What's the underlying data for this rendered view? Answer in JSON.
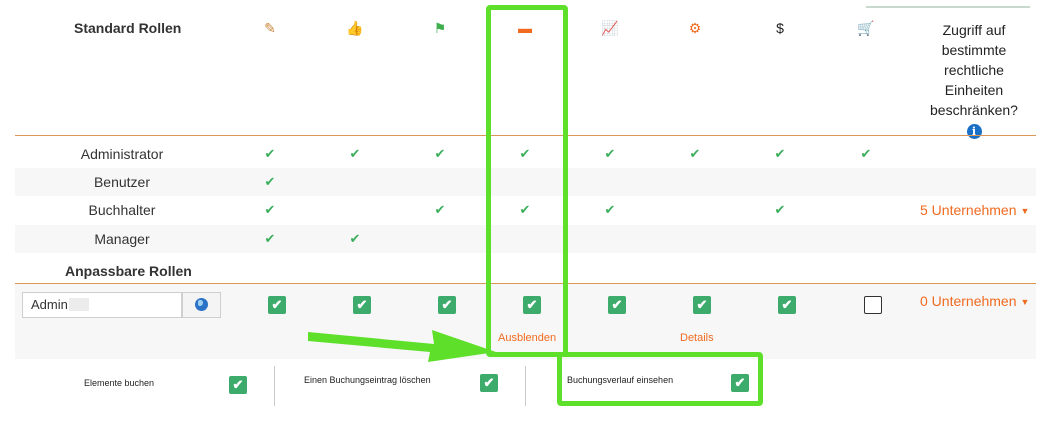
{
  "header": {
    "title": "Standard Rollen",
    "access_label": "Zugriff auf bestimmte rechtliche Einheiten beschränken?",
    "info_symbol": "i",
    "columns": [
      {
        "icon": "edit-icon",
        "glyph": "✎",
        "color": "#c8863a"
      },
      {
        "icon": "thumbs-up-icon",
        "glyph": "👍",
        "color": "#1f7ad6"
      },
      {
        "icon": "flag-icon",
        "glyph": "⚑",
        "color": "#3fae4e"
      },
      {
        "icon": "archive-icon",
        "glyph": "▬",
        "color": "#f06a20"
      },
      {
        "icon": "line-chart-icon",
        "glyph": "📈",
        "color": "#e0453a"
      },
      {
        "icon": "gear-icon",
        "glyph": "⚙",
        "color": "#f06a20"
      },
      {
        "icon": "dollar-icon",
        "glyph": "$",
        "color": "#222222"
      },
      {
        "icon": "cart-icon",
        "glyph": "🛒",
        "color": "#f06a20"
      }
    ]
  },
  "check_glyph": "✔",
  "standard_roles": [
    {
      "name": "Administrator",
      "checks": [
        true,
        true,
        true,
        true,
        true,
        true,
        true,
        true
      ],
      "companies": ""
    },
    {
      "name": "Benutzer",
      "checks": [
        true,
        false,
        false,
        false,
        false,
        false,
        false,
        false
      ],
      "companies": ""
    },
    {
      "name": "Buchhalter",
      "checks": [
        true,
        false,
        true,
        true,
        true,
        false,
        true,
        false
      ],
      "companies": "5 Unternehmen"
    },
    {
      "name": "Manager",
      "checks": [
        true,
        true,
        false,
        false,
        false,
        false,
        false,
        false
      ],
      "companies": ""
    }
  ],
  "custom_roles": {
    "title": "Anpassbare Rollen",
    "admin": {
      "input_value": "Admin",
      "checks": [
        true,
        true,
        true,
        true,
        true,
        true,
        true,
        false
      ],
      "companies": "0 Unternehmen",
      "hide_link": "Ausblenden",
      "details_link": "Details"
    }
  },
  "details_options": [
    {
      "label": "Elemente buchen",
      "checked": true
    },
    {
      "label": "Einen Buchungseintrag löschen",
      "checked": true
    },
    {
      "label": "Buchungsverlauf einsehen",
      "checked": true
    }
  ],
  "colors": {
    "accent": "#f06a20",
    "check": "#3aae5a",
    "checkbox": "#3dab6c",
    "highlight": "#5ee02a"
  }
}
